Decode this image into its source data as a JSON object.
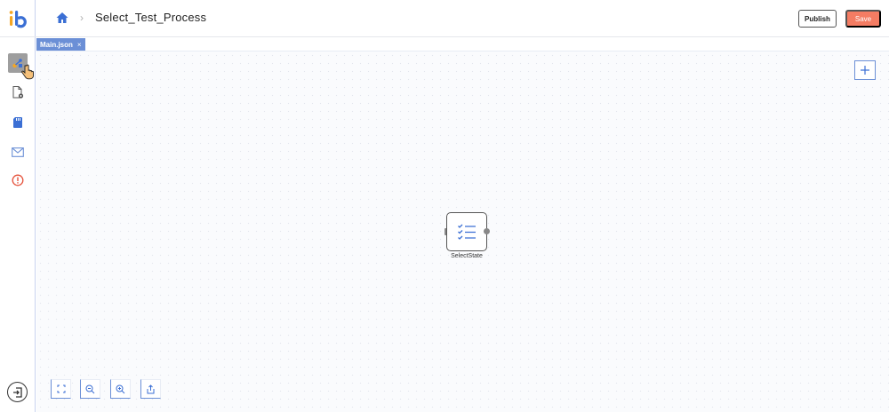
{
  "header": {
    "breadcrumb_separator": "›",
    "process_title": "Select_Test_Process",
    "publish_label": "Publish",
    "save_label": "Save"
  },
  "sidebar": {
    "items": [
      {
        "icon": "process-designer-icon",
        "active": true
      },
      {
        "icon": "document-settings-icon",
        "active": false
      },
      {
        "icon": "sd-card-icon",
        "active": false
      },
      {
        "icon": "mail-icon",
        "active": false
      },
      {
        "icon": "alert-icon",
        "active": false
      }
    ],
    "logout_icon": "logout-icon"
  },
  "tabs": [
    {
      "label": "Main.json",
      "close": "×"
    }
  ],
  "canvas": {
    "add_icon": "plus-icon",
    "nodes": [
      {
        "label": "SelectState",
        "icon": "checklist-icon"
      }
    ],
    "toolbar": [
      "fit-screen-icon",
      "zoom-out-icon",
      "zoom-in-icon",
      "export-icon"
    ]
  },
  "colors": {
    "accent": "#6b8fd6",
    "save": "#f47c63",
    "alert": "#e5533d",
    "logo_orange": "#f5a623",
    "logo_blue": "#3b6fd4"
  }
}
